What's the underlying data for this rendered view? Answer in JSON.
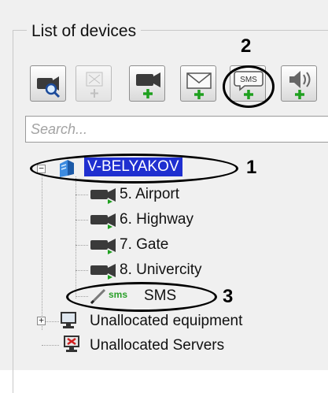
{
  "panel": {
    "title": "List of devices"
  },
  "toolbar": {
    "buttons": [
      {
        "name": "find-camera",
        "icon": "camera-search-icon"
      },
      {
        "name": "add-disabled",
        "icon": "disabled-add-icon"
      },
      {
        "name": "add-camera",
        "icon": "camera-add-icon"
      },
      {
        "name": "add-email",
        "icon": "envelope-add-icon"
      },
      {
        "name": "add-sms",
        "icon": "sms-add-icon",
        "label": "SMS"
      },
      {
        "name": "add-speaker",
        "icon": "speaker-add-icon"
      }
    ]
  },
  "search": {
    "placeholder": "Search..."
  },
  "tree": {
    "root": {
      "label": "V-BELYAKOV",
      "expander": "−"
    },
    "cameras": [
      {
        "label": "5. Airport"
      },
      {
        "label": "6. Highway"
      },
      {
        "label": "7. Gate"
      },
      {
        "label": "8. Univercity"
      }
    ],
    "sms": {
      "label": "SMS",
      "icon_text": "sms"
    },
    "unallocated_equipment": {
      "label": "Unallocated equipment",
      "expander": "+"
    },
    "unallocated_servers": {
      "label": "Unallocated Servers"
    }
  },
  "callouts": {
    "one": "1",
    "two": "2",
    "three": "3"
  },
  "colors": {
    "selection": "#1f2fd0",
    "plus_green": "#1fa01f",
    "sms_green": "#2aa02a"
  }
}
